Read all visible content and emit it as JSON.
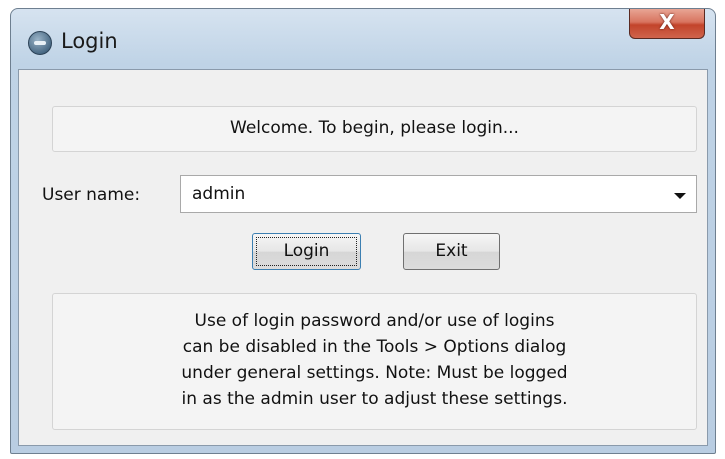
{
  "window": {
    "title": "Login",
    "close_glyph": "X",
    "icon": "app-icon"
  },
  "welcome": {
    "text": "Welcome.  To begin, please login..."
  },
  "user": {
    "label": "User name:",
    "value": "admin"
  },
  "buttons": {
    "login": "Login",
    "exit": "Exit"
  },
  "info": {
    "lines": [
      "Use of login password and/or use of logins",
      "can be disabled in the Tools > Options dialog",
      "under general settings. Note: Must be logged",
      "in as the admin user to adjust these settings."
    ]
  },
  "colors": {
    "close_button": "#c2442b",
    "window_frame": "#bfd3e6",
    "client_background": "#f0f0f0"
  }
}
